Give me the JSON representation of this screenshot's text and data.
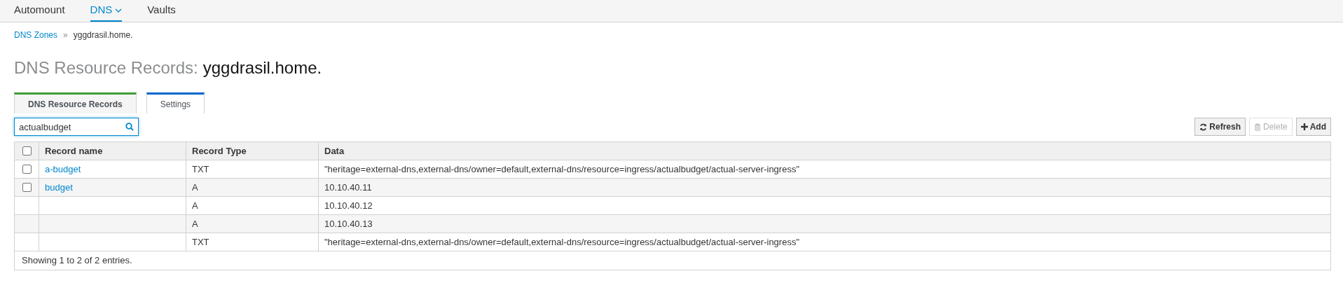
{
  "nav": [
    {
      "label": "Automount",
      "selected": false,
      "dropdown": false
    },
    {
      "label": "DNS",
      "selected": true,
      "dropdown": true
    },
    {
      "label": "Vaults",
      "selected": false,
      "dropdown": false
    }
  ],
  "breadcrumb": {
    "link": "DNS Zones",
    "separator": "»",
    "current": "yggdrasil.home."
  },
  "heading": {
    "prefix": "DNS Resource Records:",
    "name": "yggdrasil.home."
  },
  "tabs": [
    {
      "label": "DNS Resource Records",
      "selected": true
    },
    {
      "label": "Settings",
      "selected": false
    }
  ],
  "search": {
    "value": "actualbudget"
  },
  "buttons": [
    {
      "label": "Refresh",
      "kind": "refresh",
      "disabled": false
    },
    {
      "label": "Delete",
      "kind": "trash",
      "disabled": true
    },
    {
      "label": "Add",
      "kind": "plus",
      "disabled": false
    }
  ],
  "table": {
    "select_all": {
      "checked": false
    },
    "columns": [
      "Record name",
      "Record Type",
      "Data"
    ],
    "rows": [
      {
        "checked": false,
        "name": "a-budget",
        "type": "TXT",
        "data": "\"heritage=external-dns,external-dns/owner=default,external-dns/resource=ingress/actualbudget/actual-server-ingress\""
      },
      {
        "checked": false,
        "name": "budget",
        "type": "A",
        "data": "10.10.40.11"
      },
      {
        "type": "A",
        "data": "10.10.40.12"
      },
      {
        "type": "A",
        "data": "10.10.40.13"
      },
      {
        "type": "TXT",
        "data": "\"heritage=external-dns,external-dns/owner=default,external-dns/resource=ingress/actualbudget/actual-server-ingress\""
      }
    ],
    "footer": "Showing 1 to 2 of 2 entries."
  }
}
